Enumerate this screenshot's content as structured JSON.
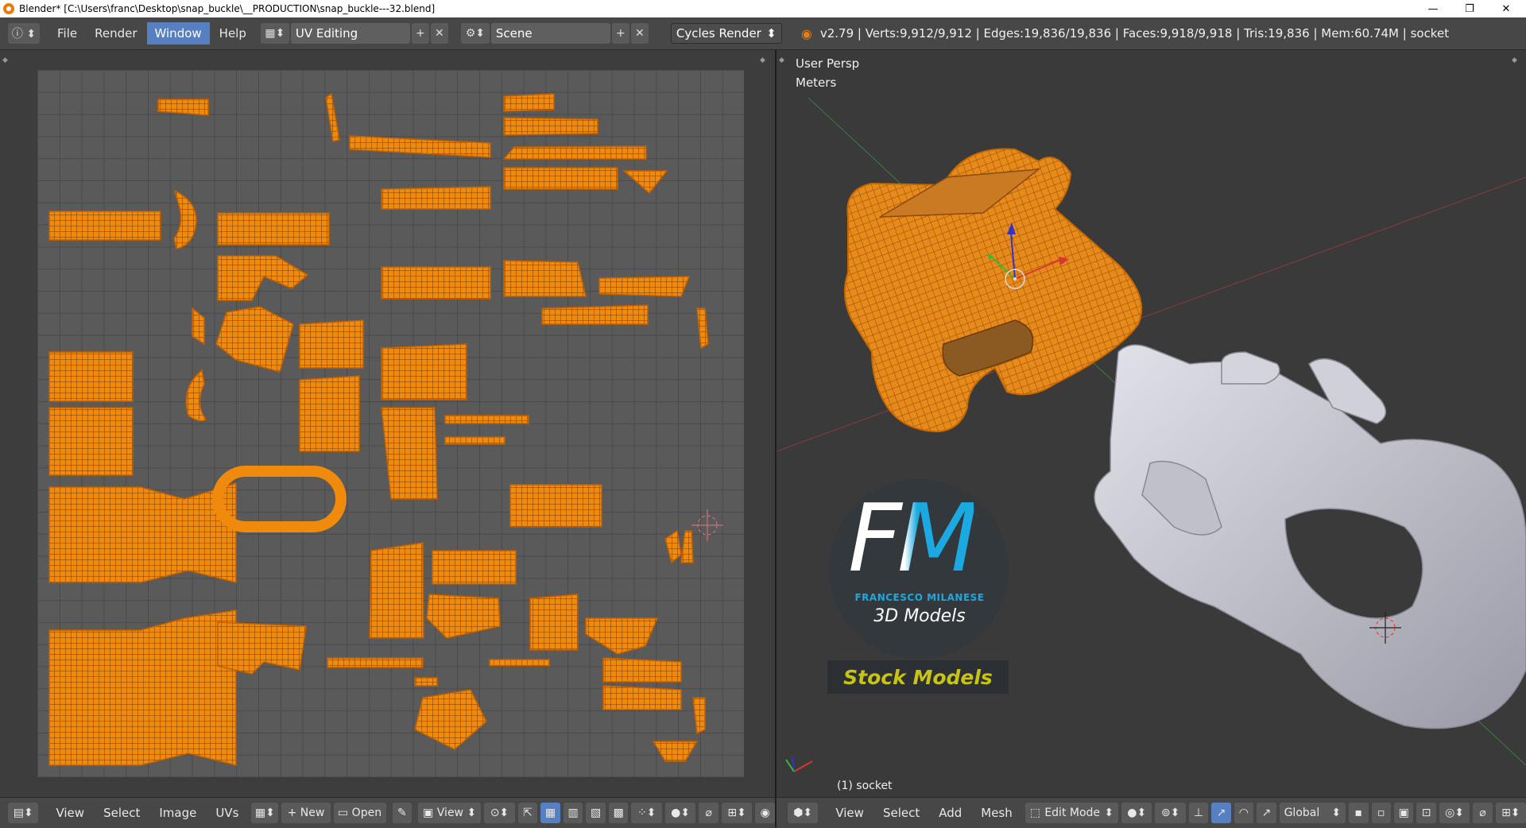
{
  "window": {
    "title": "Blender* [C:\\Users\\franc\\Desktop\\snap_buckle\\__PRODUCTION\\snap_buckle---32.blend]",
    "minimize": "—",
    "maximize": "❐",
    "close": "✕"
  },
  "topbar": {
    "menus": [
      "File",
      "Render",
      "Window",
      "Help"
    ],
    "active_menu": "Window",
    "screen_layout": "UV Editing",
    "scene": "Scene",
    "render_engine": "Cycles Render",
    "stats": "v2.79 | Verts:9,912/9,912 | Edges:19,836/19,836 | Faces:9,918/9,918 | Tris:19,836 | Mem:60.74M | socket"
  },
  "viewport": {
    "view_name": "User Persp",
    "units": "Meters",
    "object_label": "(1) socket"
  },
  "watermark": {
    "initials": "FM",
    "name": "FRANCESCO MILANESE",
    "tagline": "3D Models",
    "badge": "Stock Models"
  },
  "uv_footer": {
    "menus": [
      "View",
      "Select",
      "Image",
      "UVs"
    ],
    "new_label": "New",
    "open_label": "Open",
    "view_label": "View"
  },
  "vp_footer": {
    "menus": [
      "View",
      "Select",
      "Add",
      "Mesh"
    ],
    "mode": "Edit Mode",
    "orientation": "Global"
  },
  "colors": {
    "accent": "#5680c2",
    "uv_orange": "#ef8a0c",
    "mesh_grey": "#c8c8d2"
  }
}
